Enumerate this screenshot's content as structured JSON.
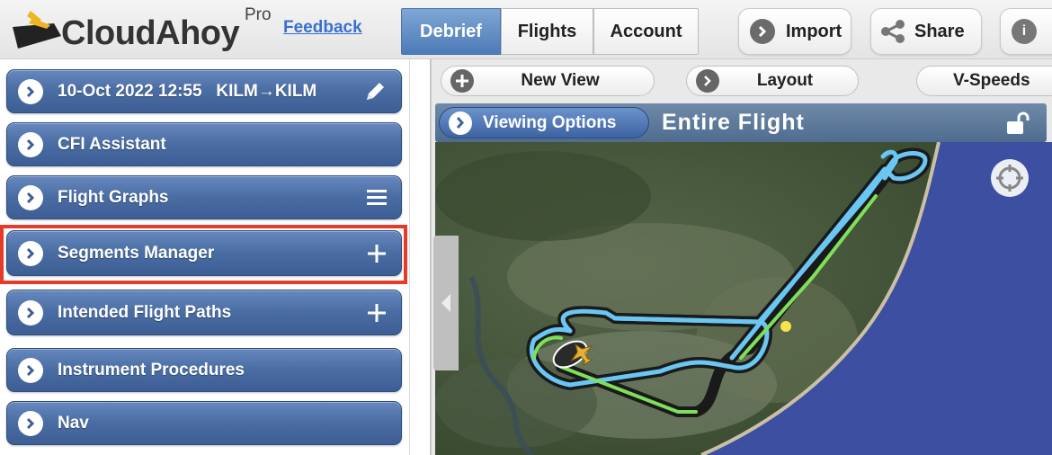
{
  "app": {
    "logo_text": "CloudAhoy",
    "edition": "Pro",
    "feedback_label": "Feedback"
  },
  "tabs": [
    {
      "label": "Debrief",
      "active": true
    },
    {
      "label": "Flights",
      "active": false
    },
    {
      "label": "Account",
      "active": false
    }
  ],
  "toolbar": {
    "import_label": "Import",
    "share_label": "Share"
  },
  "sidebar": {
    "items": [
      {
        "label": "10-Oct 2022 12:55   KILM→KILM",
        "right_icon": "pencil-icon"
      },
      {
        "label": "CFI Assistant",
        "right_icon": ""
      },
      {
        "label": "Flight Graphs",
        "right_icon": "menu-icon"
      },
      {
        "label": "Segments Manager",
        "right_icon": "plus-icon",
        "highlighted": true
      },
      {
        "label": "Intended Flight Paths",
        "right_icon": "plus-icon"
      },
      {
        "label": "Instrument Procedures",
        "right_icon": ""
      },
      {
        "label": "Nav",
        "right_icon": ""
      }
    ]
  },
  "view_toolbar": {
    "new_view_label": "New View",
    "layout_label": "Layout",
    "vspeeds_label": "V-Speeds"
  },
  "map": {
    "viewing_options_label": "Viewing Options",
    "title": "Entire Flight"
  },
  "colors": {
    "sidebar_button": "#4a6da4",
    "active_tab": "#5a85bf",
    "highlight_border": "#e63a2a",
    "track_blue": "#6ac6f2",
    "track_green": "#7ee05a",
    "ocean": "#3d4fa0",
    "land": "#3f5232"
  }
}
